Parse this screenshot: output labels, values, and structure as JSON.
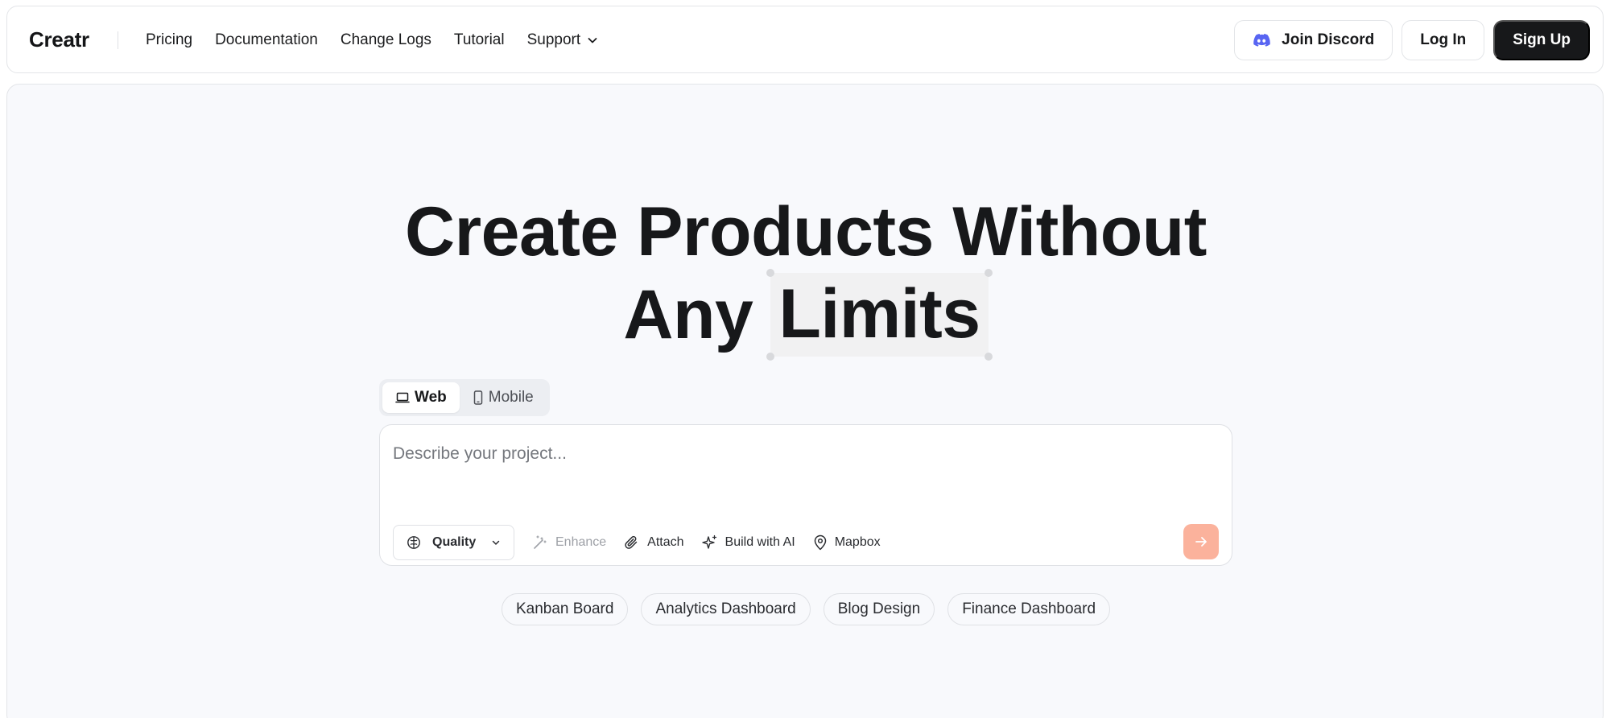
{
  "brand": "Creatr",
  "nav": {
    "links": [
      "Pricing",
      "Documentation",
      "Change Logs",
      "Tutorial",
      "Support"
    ],
    "discord_label": "Join Discord",
    "login_label": "Log In",
    "signup_label": "Sign Up"
  },
  "hero": {
    "line1": "Create Products Without",
    "line2_prefix": "Any",
    "line2_highlight": "Limits"
  },
  "platform": {
    "options": [
      "Web",
      "Mobile"
    ],
    "selected": "Web"
  },
  "prompt": {
    "placeholder": "Describe your project...",
    "value": ""
  },
  "toolbar": {
    "quality_label": "Quality",
    "enhance_label": "Enhance",
    "attach_label": "Attach",
    "build_ai_label": "Build with AI",
    "mapbox_label": "Mapbox"
  },
  "suggestions": [
    "Kanban Board",
    "Analytics Dashboard",
    "Blog Design",
    "Finance Dashboard"
  ],
  "colors": {
    "accent_send": "#fbb29c",
    "discord": "#5865f2",
    "dark_button": "#17181a",
    "canvas_bg": "#f8f9fc"
  },
  "icons": {
    "discord": "discord-icon",
    "support_chevron": "chevron-down-icon",
    "web": "laptop-icon",
    "mobile": "phone-icon",
    "quality": "brain-icon",
    "enhance": "magic-wand-icon",
    "attach": "paperclip-icon",
    "build_ai": "sparkles-icon",
    "mapbox": "map-pin-icon",
    "send": "arrow-right-icon"
  }
}
